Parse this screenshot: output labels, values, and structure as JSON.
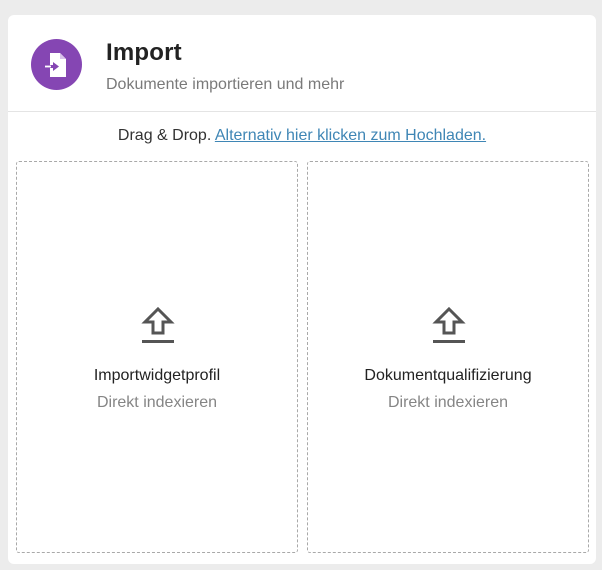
{
  "widget": {
    "title": "Import",
    "subtitle": "Dokumente importieren und mehr",
    "icon": "file-import-icon",
    "accent_color": "#8546b3"
  },
  "hint": {
    "text": "Drag & Drop.",
    "link_label": "Alternativ hier klicken zum Hochladen.",
    "link_color": "#3f86b5"
  },
  "dropzones": [
    {
      "label": "Importwidgetprofil",
      "sublabel": "Direkt indexieren",
      "icon": "upload-icon"
    },
    {
      "label": "Dokumentqualifizierung",
      "sublabel": "Direkt indexieren",
      "icon": "upload-icon"
    }
  ]
}
